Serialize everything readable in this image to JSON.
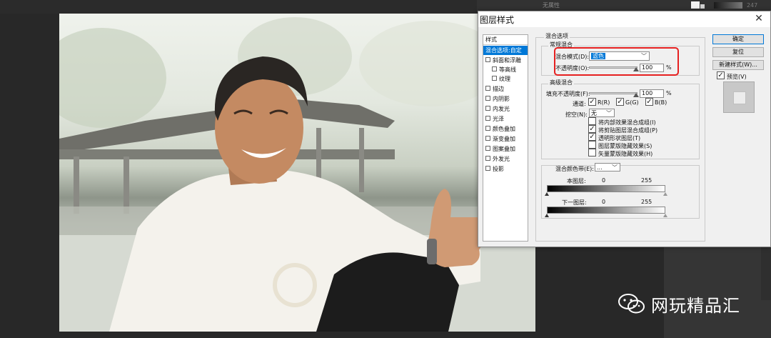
{
  "workspace": {
    "top_panel_label": "无属性",
    "top_panel_number": "247",
    "colors": {
      "workspace_bg": "#282828",
      "dialog_bg": "#f0f0f0",
      "selection": "#0078d7",
      "highlight_box": "#e62020"
    }
  },
  "dialog": {
    "title": "图层样式",
    "close_icon": "close-icon",
    "styles_header": "样式",
    "styles": [
      {
        "label": "混合选项:自定",
        "selected": true,
        "checkbox": false
      },
      {
        "label": "斜面和浮雕",
        "selected": false,
        "checkbox": true
      },
      {
        "label": "等高线",
        "selected": false,
        "checkbox": true,
        "indent": true
      },
      {
        "label": "纹理",
        "selected": false,
        "checkbox": true,
        "indent": true
      },
      {
        "label": "描边",
        "selected": false,
        "checkbox": true
      },
      {
        "label": "内阴影",
        "selected": false,
        "checkbox": true
      },
      {
        "label": "内发光",
        "selected": false,
        "checkbox": true
      },
      {
        "label": "光泽",
        "selected": false,
        "checkbox": true
      },
      {
        "label": "颜色叠加",
        "selected": false,
        "checkbox": true
      },
      {
        "label": "渐变叠加",
        "selected": false,
        "checkbox": true
      },
      {
        "label": "图案叠加",
        "selected": false,
        "checkbox": true
      },
      {
        "label": "外发光",
        "selected": false,
        "checkbox": true
      },
      {
        "label": "投影",
        "selected": false,
        "checkbox": true
      }
    ],
    "blend_options": {
      "title": "混合选项",
      "general": {
        "title": "常规混合",
        "blend_mode_label": "混合模式(D):",
        "blend_mode_value": "滤色",
        "opacity_label": "不透明度(O):",
        "opacity_value": "100",
        "opacity_unit": "%"
      },
      "advanced": {
        "title": "高级混合",
        "fill_opacity_label": "填充不透明度(F):",
        "fill_opacity_value": "100",
        "fill_opacity_unit": "%",
        "channels_label": "通道:",
        "channel_r": "R(R)",
        "channel_g": "G(G)",
        "channel_b": "B(B)",
        "knockout_label": "挖空(N):",
        "knockout_value": "无",
        "options": [
          {
            "label": "将内部效果混合成组(I)",
            "checked": false
          },
          {
            "label": "将剪贴图层混合成组(P)",
            "checked": true
          },
          {
            "label": "透明形状图层(T)",
            "checked": true
          },
          {
            "label": "图层蒙版隐藏效果(S)",
            "checked": false
          },
          {
            "label": "矢量蒙版隐藏效果(H)",
            "checked": false
          }
        ]
      },
      "blend_if": {
        "label": "混合颜色带(E):",
        "value": "...",
        "this_layer_label": "本图层:",
        "this_layer_min": "0",
        "this_layer_max": "255",
        "under_layer_label": "下一图层:",
        "under_layer_min": "0",
        "under_layer_max": "255"
      }
    },
    "buttons": {
      "ok": "确定",
      "reset": "复位",
      "new_style": "新建样式(W)...",
      "preview": "预览(V)"
    }
  },
  "watermark": {
    "icon": "wechat-icon",
    "text": "网玩精品汇"
  }
}
